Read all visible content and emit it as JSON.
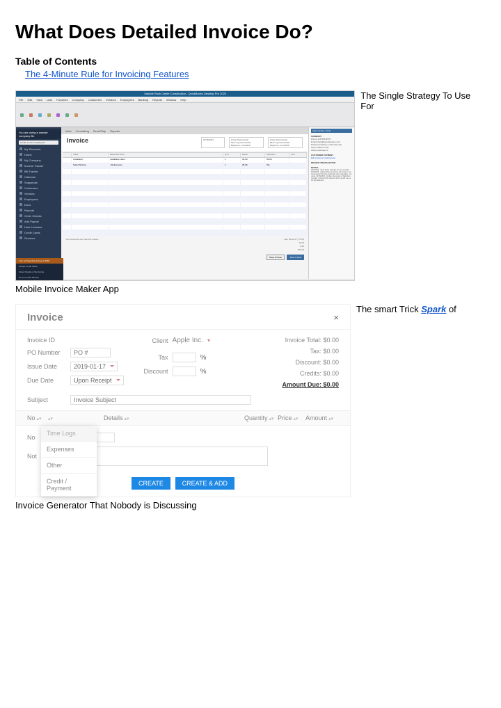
{
  "page_title": "What Does Detailed Invoice Do?",
  "toc": {
    "title": "Table of Contents",
    "link": "The 4-Minute Rule for Invoicing Features"
  },
  "caption1_right": "The Single Strategy To Use For",
  "caption1_below": "Mobile Invoice Maker App",
  "caption2_prefix": "The smart Trick ",
  "caption2_link": "Spark",
  "caption2_suffix": " of",
  "caption2_below": "Invoice Generator That Nobody is Discussing",
  "qb": {
    "title": "Sample Rock Castle Construction - QuickBooks Desktop Pro 2020",
    "menu": [
      "File",
      "Edit",
      "View",
      "Lists",
      "Favorites",
      "Company",
      "Customers",
      "Vendors",
      "Employees",
      "Banking",
      "Reports",
      "Window",
      "Help"
    ],
    "side_msg": "You are using a sample company file",
    "side_btn": "Create a new company file",
    "side": [
      "My Shortcuts",
      "Home",
      "My Company",
      "Income Tracker",
      "Bill Tracker",
      "Calendar",
      "Snapshots",
      "Customers",
      "Vendors",
      "Employees",
      "Docs",
      "Reports",
      "Order Checks",
      "Add Payroll",
      "User Licenses",
      "Credit Cards",
      "Services"
    ],
    "side_warn": "Turn on Payroll & start up to 50%",
    "side_dark1": "Accept Credit Cards",
    "side_dark2": "Order Checks & Tax Forms",
    "side_dark3": "Do more with Tsheets",
    "tab": [
      "Main",
      "Formatting",
      "Send/Ship",
      "Reports"
    ],
    "doc": "Invoice",
    "date": "07/15/2024",
    "bill_to": "Kristy Abercrombie\n5647 Cypress Hill Rd\nBayshore, CA 94326",
    "cols": [
      "",
      "ITEM",
      "DESCRIPTION",
      "QTY",
      "RATE",
      "AMOUNT",
      "TAX"
    ],
    "rows": [
      [
        "",
        "Installation",
        "Installation labor",
        "1",
        "35.00",
        "35.00",
        ""
      ],
      [
        "",
        "Subs:Painting",
        "• Deliverance",
        "1",
        "35.00",
        "Tax",
        ""
      ]
    ],
    "foot_memo": "Your customer can't see this unless...",
    "foot_tax": "San Tomas ▾  (7.75%)",
    "total": "70.00",
    "pay": "0.00",
    "bal": "$70.00",
    "btns": [
      "Save & Close",
      "Save & New"
    ],
    "right_name": "Abercrombie, Kristy",
    "right_phone": "415-555-6579",
    "right_email": "kristy@samplename.com",
    "right_sec1": "SUMMARY",
    "right_sec2": "CUSTOMER PAYMENT",
    "right_sec3": "RECENT TRANSACTION",
    "right_sec4": "NOTES",
    "right_pref": "Preferred delivery method  E-mail",
    "right_open": "Open balance  0.00",
    "right_active": "Active estimates  0",
    "right_link": "Edit customer preferences",
    "right_note": "9/15/2003 - Send Kristy estimate for den remodel. 9/20/2003 - Called Kristy to discuss job. Kristy is not interested at this time. Estimate was competitive, not using. 10/15/2003 - Further discussion of bathroom remodel. I offered 10% discount if she would use us for the bathroom."
  },
  "inv": {
    "title": "Invoice",
    "labels": {
      "id": "Invoice ID",
      "po": "PO Number",
      "issue": "Issue Date",
      "due": "Due Date",
      "subject": "Subject",
      "client": "Client",
      "tax": "Tax",
      "discount": "Discount"
    },
    "po_ph": "PO #",
    "issue_date": "2019-01-17",
    "due_val": "Upon Receipt",
    "subject_ph": "Invoice Subject",
    "client": "Apple Inc.",
    "pct": "%",
    "tot": {
      "total": "Invoice Total: $0.00",
      "tax": "Tax: $0.00",
      "disc": "Discount: $0.00",
      "cred": "Credits: $0.00",
      "due": "Amount Due: $0.00"
    },
    "th": [
      "No",
      "",
      "Details",
      "Quantity",
      "Price",
      "Amount",
      ""
    ],
    "dd": [
      "Time Logs",
      "Expenses",
      "Other",
      "Credit / Payment"
    ],
    "note": "Not",
    "btns": [
      "CREATE",
      "CREATE & ADD"
    ]
  }
}
